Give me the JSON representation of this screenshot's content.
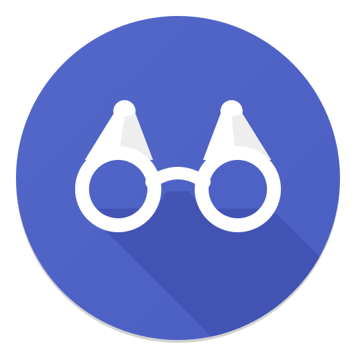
{
  "app_icon": {
    "icon_name": "binoculars-icon",
    "colors": {
      "background_circle": "#4a5ec3",
      "background_circle_light": "#5468c9",
      "long_shadow": "#3f4fae",
      "binoculars": "#ffffff",
      "binocular_barrel_shade": "#eeeeee"
    }
  }
}
